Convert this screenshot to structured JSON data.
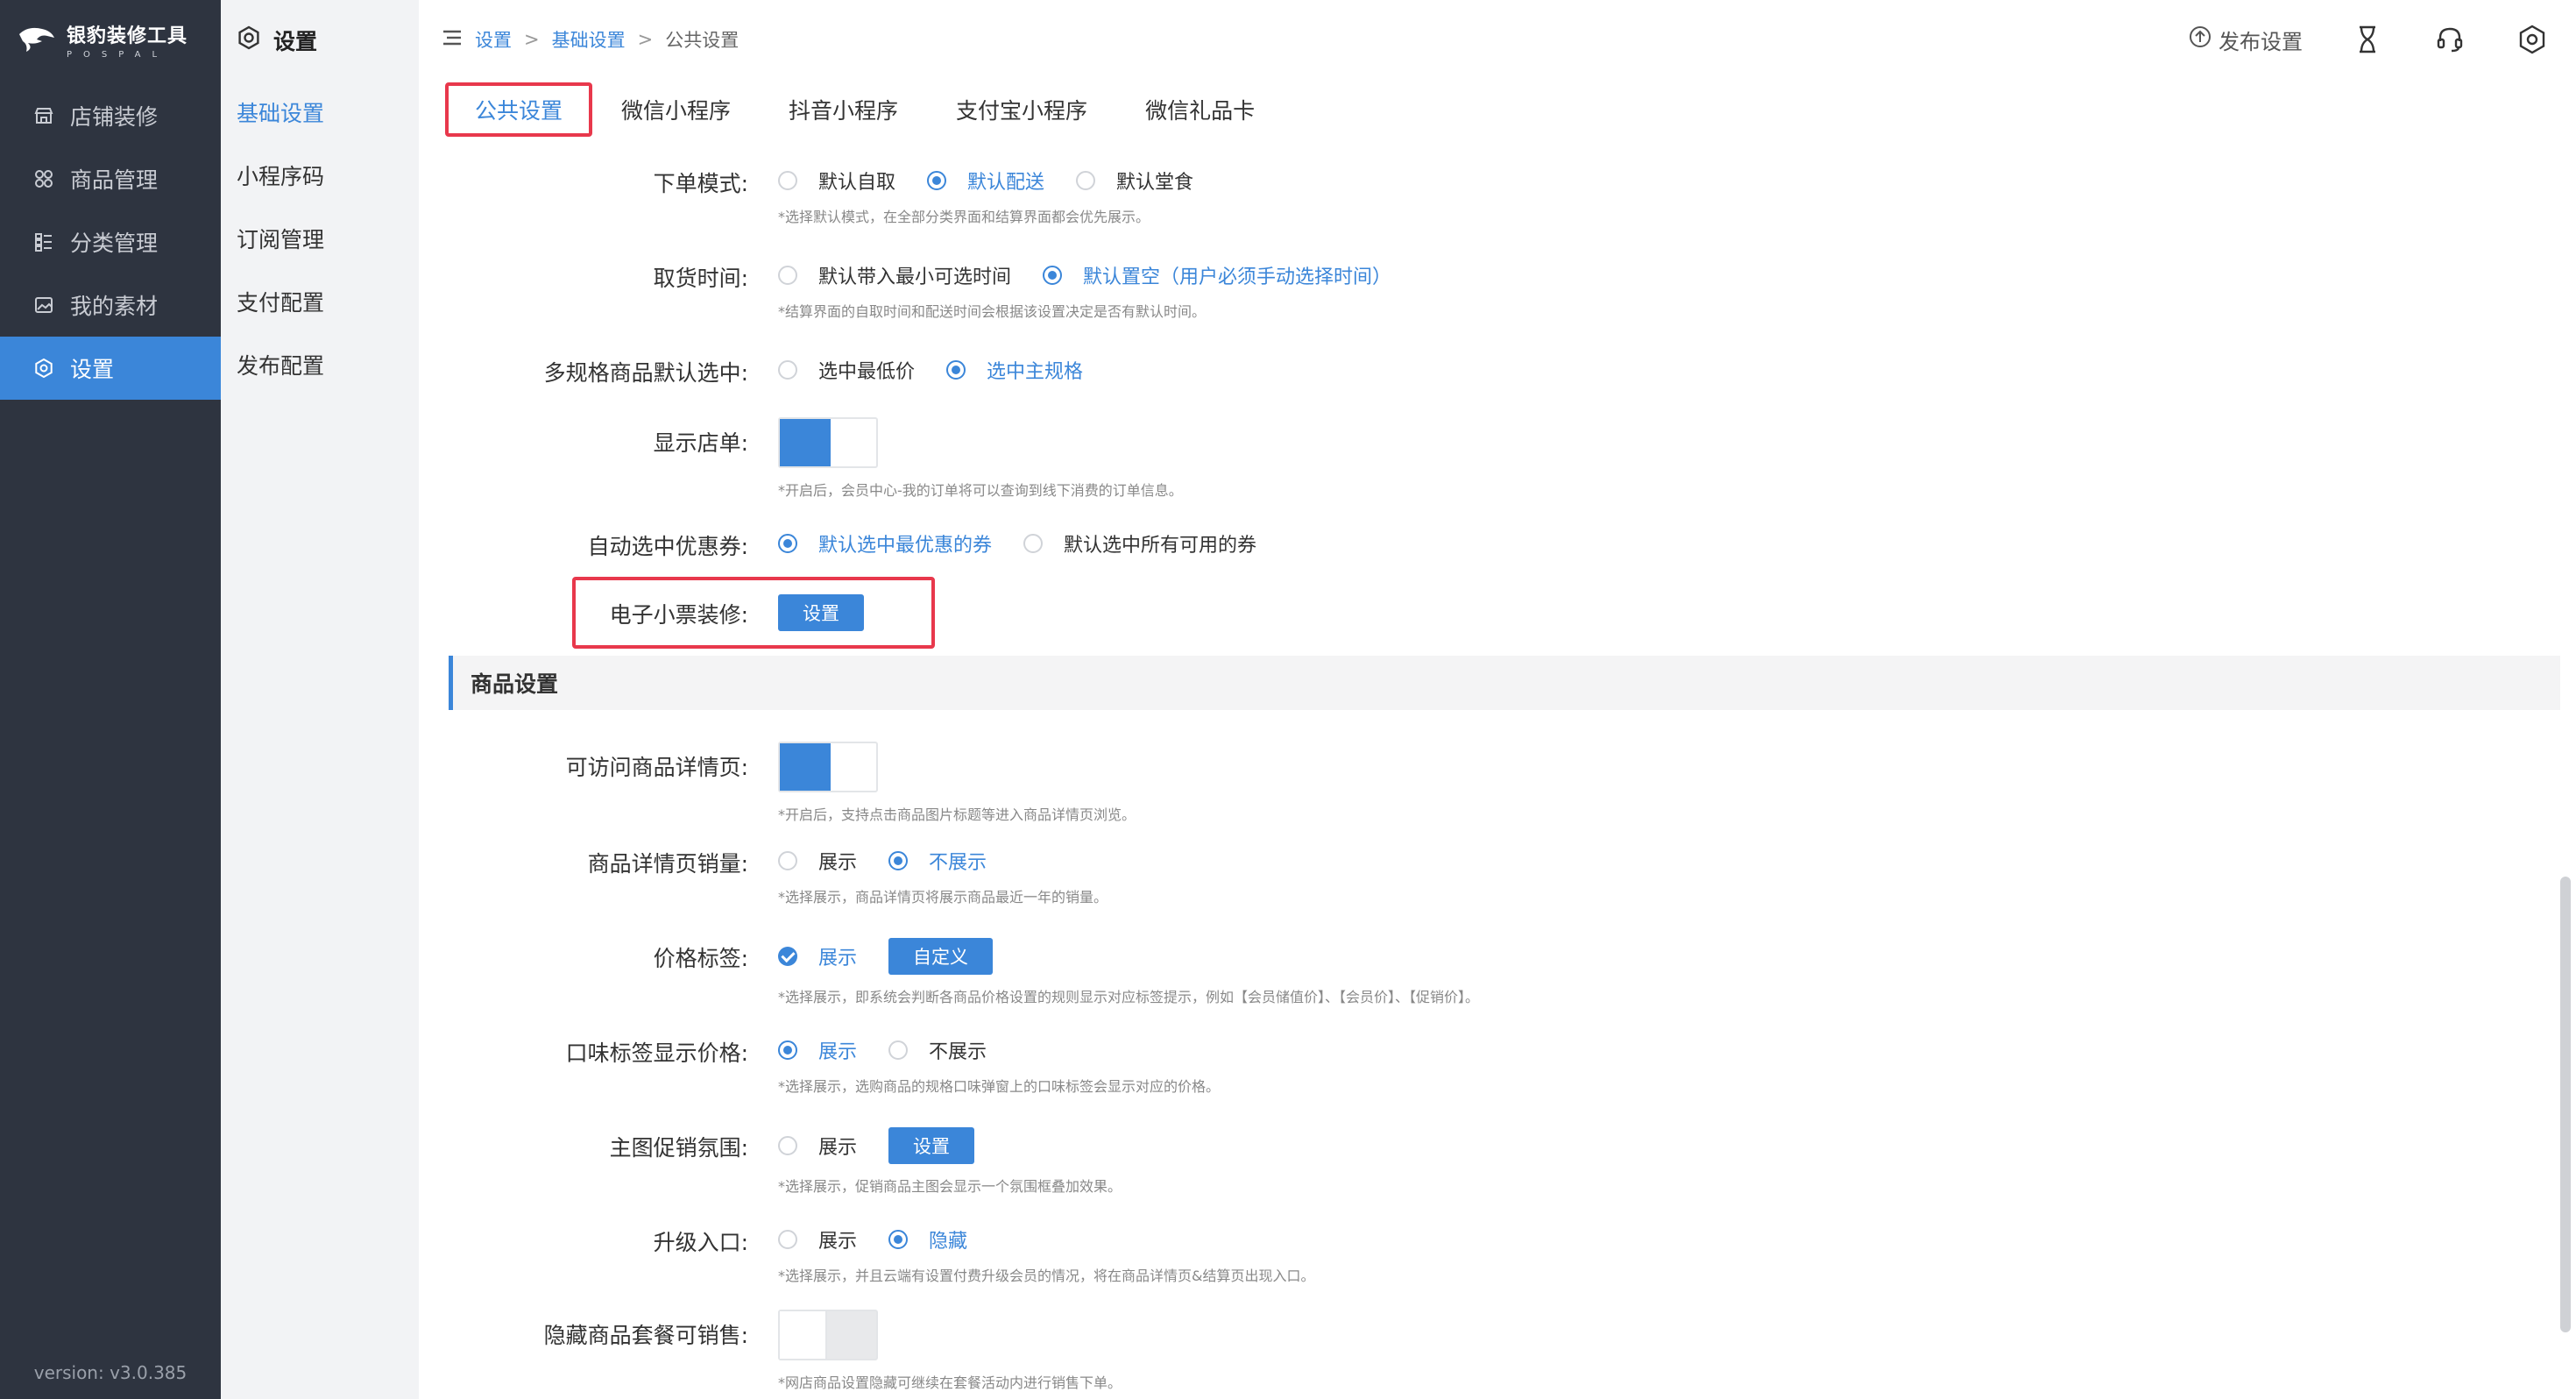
{
  "app": {
    "name": "银豹装修工具",
    "brand_sub": "POSPAL",
    "version": "version: v3.0.385",
    "accent": "#3b86d9"
  },
  "sidebar": {
    "items": [
      {
        "label": "店铺装修",
        "icon": "store-icon"
      },
      {
        "label": "商品管理",
        "icon": "grid-icon"
      },
      {
        "label": "分类管理",
        "icon": "list-icon"
      },
      {
        "label": "我的素材",
        "icon": "image-icon"
      },
      {
        "label": "设置",
        "icon": "gear-icon",
        "active": true
      }
    ]
  },
  "subnav": {
    "title": "设置",
    "items": [
      {
        "label": "基础设置",
        "active": true
      },
      {
        "label": "小程序码"
      },
      {
        "label": "订阅管理"
      },
      {
        "label": "支付配置"
      },
      {
        "label": "发布配置"
      }
    ]
  },
  "breadcrumb": {
    "root": "设置",
    "sep": ">",
    "mid": "基础设置",
    "current": "公共设置"
  },
  "top": {
    "publish_label": "发布设置"
  },
  "tabs": [
    "公共设置",
    "微信小程序",
    "抖音小程序",
    "支付宝小程序",
    "微信礼品卡"
  ],
  "settings": {
    "order_mode": {
      "label": "下单模式:",
      "options": [
        "默认自取",
        "默认配送",
        "默认堂食"
      ],
      "selected": 1,
      "hint": "*选择默认模式，在全部分类界面和结算界面都会优先展示。"
    },
    "pickup_time": {
      "label": "取货时间:",
      "options": [
        "默认带入最小可选时间",
        "默认置空（用户必须手动选择时间）"
      ],
      "selected": 1,
      "hint": "*结算界面的自取时间和配送时间会根据该设置决定是否有默认时间。"
    },
    "multi_spec": {
      "label": "多规格商品默认选中:",
      "options": [
        "选中最低价",
        "选中主规格"
      ],
      "selected": 1
    },
    "show_store_order": {
      "label": "显示店单:",
      "on": true,
      "hint": "*开启后，会员中心-我的订单将可以查询到线下消费的订单信息。"
    },
    "auto_coupon": {
      "label": "自动选中优惠券:",
      "options": [
        "默认选中最优惠的券",
        "默认选中所有可用的券"
      ],
      "selected": 0
    },
    "e_receipt": {
      "label": "电子小票装修:",
      "button": "设置"
    }
  },
  "product_section": {
    "title": "商品设置",
    "detail_page": {
      "label": "可访问商品详情页:",
      "on": true,
      "hint": "*开启后，支持点击商品图片标题等进入商品详情页浏览。"
    },
    "detail_sales": {
      "label": "商品详情页销量:",
      "options": [
        "展示",
        "不展示"
      ],
      "selected": 1,
      "hint": "*选择展示，商品详情页将展示商品最近一年的销量。"
    },
    "price_tag": {
      "label": "价格标签:",
      "option": "展示",
      "button": "自定义",
      "hint": "*选择展示，即系统会判断各商品价格设置的规则显示对应标签提示，例如【会员储值价】、【会员价】、【促销价】。"
    },
    "flavor_price": {
      "label": "口味标签显示价格:",
      "options": [
        "展示",
        "不展示"
      ],
      "selected": 0,
      "hint": "*选择展示，选购商品的规格口味弹窗上的口味标签会显示对应的价格。"
    },
    "promo_atmos": {
      "label": "主图促销氛围:",
      "option": "展示",
      "button": "设置",
      "hint": "*选择展示，促销商品主图会显示一个氛围框叠加效果。"
    },
    "upgrade_entry": {
      "label": "升级入口:",
      "options": [
        "展示",
        "隐藏"
      ],
      "selected": 1,
      "hint": "*选择展示，并且云端有设置付费升级会员的情况，将在商品详情页&结算页出现入口。"
    },
    "hidden_combo": {
      "label": "隐藏商品套餐可销售:",
      "on": false,
      "hint": "*网店商品设置隐藏可继续在套餐活动内进行销售下单。"
    }
  }
}
